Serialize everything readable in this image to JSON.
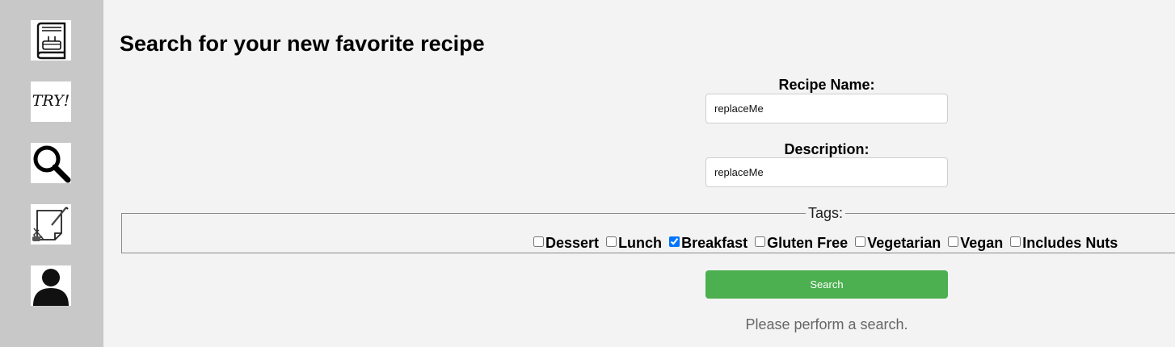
{
  "sidebar": {
    "items": [
      {
        "name": "cookbook",
        "icon": "cookbook-icon"
      },
      {
        "name": "try",
        "icon": "try-icon",
        "label": "TRY!"
      },
      {
        "name": "search",
        "icon": "search-icon"
      },
      {
        "name": "create-recipe",
        "icon": "notepad-pencil-icon"
      },
      {
        "name": "profile",
        "icon": "user-icon"
      }
    ]
  },
  "main": {
    "title": "Search for your new favorite recipe",
    "recipe_name": {
      "label": "Recipe Name:",
      "value": "replaceMe"
    },
    "description": {
      "label": "Description:",
      "value": "replaceMe"
    },
    "tags": {
      "legend": "Tags:",
      "options": [
        {
          "label": "Dessert",
          "checked": false
        },
        {
          "label": "Lunch",
          "checked": false
        },
        {
          "label": "Breakfast",
          "checked": true
        },
        {
          "label": "Gluten Free",
          "checked": false
        },
        {
          "label": "Vegetarian",
          "checked": false
        },
        {
          "label": "Vegan",
          "checked": false
        },
        {
          "label": "Includes Nuts",
          "checked": false
        }
      ]
    },
    "search_button": "Search",
    "status": "Please perform a search."
  },
  "colors": {
    "sidebar": "#c8c8c8",
    "background": "#f3f3f3",
    "button": "#4caf50"
  }
}
